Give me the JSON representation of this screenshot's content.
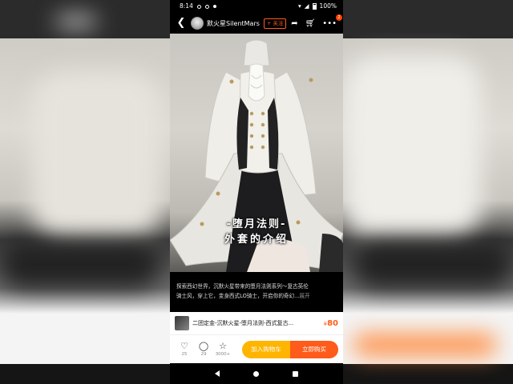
{
  "status": {
    "time": "8:14",
    "battery": "100%"
  },
  "header": {
    "author": "默火星SilentMars",
    "follow_label": "+ 关注",
    "cart_badge": "2"
  },
  "video": {
    "overlay_line1": "-堕月法则-",
    "overlay_line2": "外套的介绍"
  },
  "description": {
    "line1": "探索西幻世界，沉默火星带来的堕月法则系列～复古英伦",
    "line2": "骑士风，穿上它，变身西式LO骑士，开启你的奇幻...",
    "more": "展开"
  },
  "product": {
    "name": "二团定金-沉默火星-堕月法则-西式复古...",
    "currency": "¥",
    "price": "80"
  },
  "actions": {
    "like_count": "25",
    "comment_count": "29",
    "fav_count": "3000+",
    "add_cart_label": "加入购物车",
    "buy_label": "立即购买"
  },
  "icons": [
    "back-icon",
    "share-icon",
    "cart-icon",
    "more-icon",
    "heart-icon",
    "comment-icon",
    "star-icon"
  ],
  "colors": {
    "accent": "#ff5b1a",
    "cart_button": "#ffb400"
  }
}
